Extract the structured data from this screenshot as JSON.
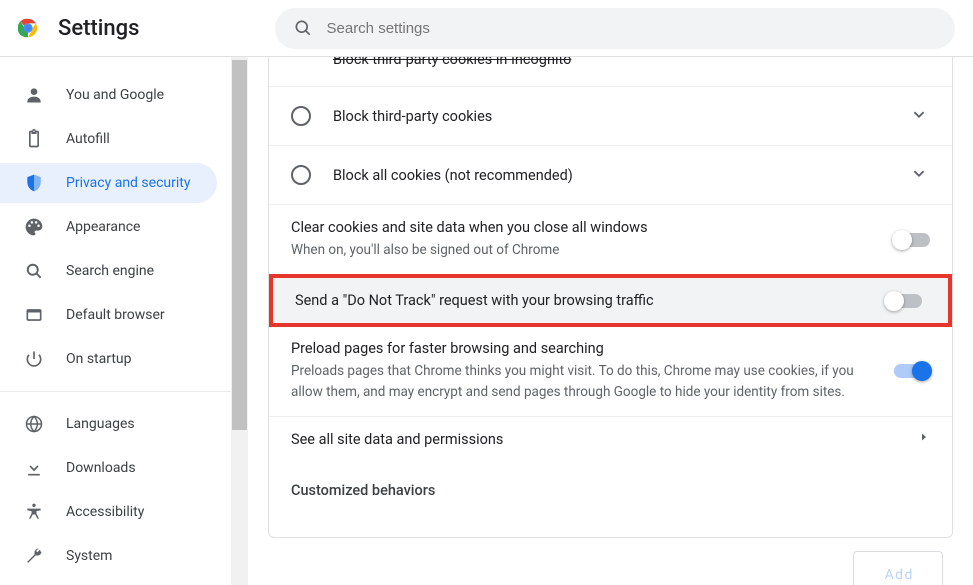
{
  "header": {
    "title": "Settings",
    "search_placeholder": "Search settings"
  },
  "sidebar": {
    "items": [
      {
        "label": "You and Google"
      },
      {
        "label": "Autofill"
      },
      {
        "label": "Privacy and security"
      },
      {
        "label": "Appearance"
      },
      {
        "label": "Search engine"
      },
      {
        "label": "Default browser"
      },
      {
        "label": "On startup"
      }
    ],
    "advanced_items": [
      {
        "label": "Languages"
      },
      {
        "label": "Downloads"
      },
      {
        "label": "Accessibility"
      },
      {
        "label": "System"
      }
    ]
  },
  "cookies": {
    "cut_option": "Block third-party cookies in Incognito",
    "option2": "Block third-party cookies",
    "option3": "Block all cookies (not recommended)"
  },
  "clear": {
    "title": "Clear cookies and site data when you close all windows",
    "sub": "When on, you'll also be signed out of Chrome"
  },
  "dnt": {
    "title": "Send a \"Do Not Track\" request with your browsing traffic"
  },
  "preload": {
    "title": "Preload pages for faster browsing and searching",
    "sub": "Preloads pages that Chrome thinks you might visit. To do this, Chrome may use cookies, if you allow them, and may encrypt and send pages through Google to hide your identity from sites."
  },
  "sitedata": {
    "title": "See all site data and permissions"
  },
  "custom": {
    "heading": "Customized behaviors"
  },
  "footer": {
    "partial_button": "A d d"
  }
}
